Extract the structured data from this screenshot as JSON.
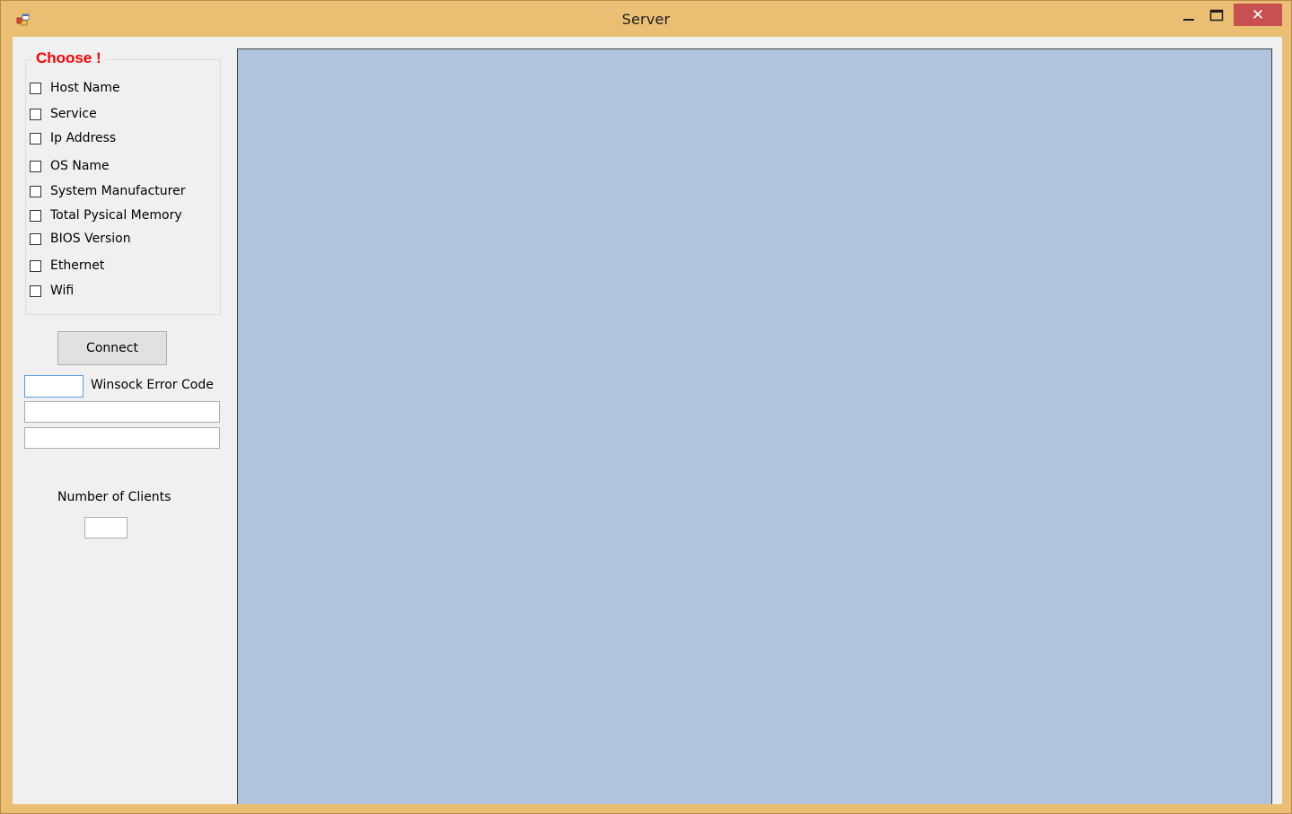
{
  "window": {
    "title": "Server",
    "app_icon": "windows-form-icon",
    "controls": {
      "minimize_icon": "minimize-icon",
      "maximize_icon": "maximize-icon",
      "close_label": "✕"
    }
  },
  "options_group": {
    "title": "Choose !",
    "items": [
      {
        "label": "Host Name",
        "checked": false
      },
      {
        "label": "Service",
        "checked": false
      },
      {
        "label": "Ip Address",
        "checked": false
      },
      {
        "label": "OS Name",
        "checked": false
      },
      {
        "label": "System Manufacturer",
        "checked": false
      },
      {
        "label": "Total Pysical Memory",
        "checked": false
      },
      {
        "label": "BIOS Version",
        "checked": false
      },
      {
        "label": "Ethernet",
        "checked": false
      },
      {
        "label": "Wifi",
        "checked": false
      }
    ]
  },
  "actions": {
    "connect_label": "Connect"
  },
  "winsock": {
    "error_code_value": "",
    "error_code_label": "Winsock Error Code",
    "field1_value": "",
    "field2_value": ""
  },
  "clients": {
    "label": "Number of Clients",
    "value": ""
  },
  "colors": {
    "window_frame": "#eabe73",
    "client_background": "#f0f0f0",
    "panel_background": "#b0c4de",
    "group_title": "#ff0000",
    "close_button": "#c75050"
  }
}
